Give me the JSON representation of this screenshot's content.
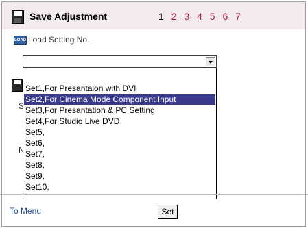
{
  "header": {
    "title": "Save Adjustment",
    "steps": [
      "1",
      "2",
      "3",
      "4",
      "5",
      "6",
      "7"
    ],
    "current_step": "1"
  },
  "load": {
    "icon": "load-icon",
    "icon_text": "LOAD",
    "label": "Load Setting No."
  },
  "dropdown": {
    "options": [
      "Set1,For Presantaion with DVI",
      "Set2,For Cinema Mode Component Input",
      "Set3,For Presantation & PC Setting",
      "Set4,For Studio Live DVD",
      "Set5,",
      "Set6,",
      "Set7,",
      "Set8,",
      "Set9,",
      "Set10,"
    ],
    "highlighted_index": 1
  },
  "footer": {
    "menu_link": "To Menu",
    "set_button": "Set"
  },
  "colors": {
    "header_bg": "#f2eaee",
    "step_color": "#b01c4e",
    "highlight": "#3a3a8c",
    "link": "#1e4a9a"
  }
}
